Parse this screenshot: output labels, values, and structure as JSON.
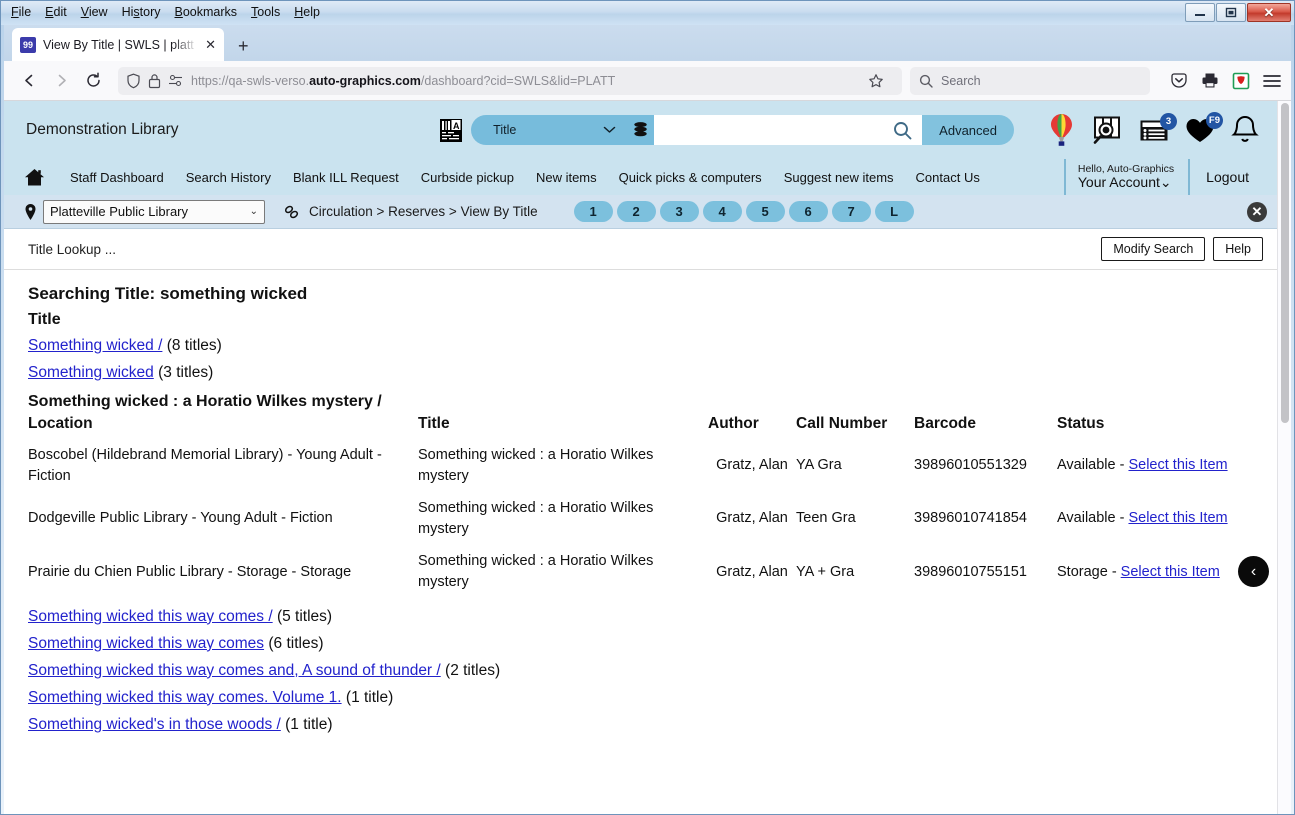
{
  "window": {
    "menus": [
      "File",
      "Edit",
      "View",
      "History",
      "Bookmarks",
      "Tools",
      "Help"
    ],
    "controls": {
      "minimize": "—",
      "maximize": "❐",
      "close": "✕"
    }
  },
  "browser": {
    "tab": {
      "title": "View By Title | SWLS | platt | Aut",
      "favicon_text": "99",
      "close": "✕"
    },
    "new_tab": "+",
    "url_prefix": "https://qa-swls-verso.",
    "url_bold": "auto-graphics.com",
    "url_suffix": "/dashboard?cid=SWLS&lid=PLATT",
    "search_placeholder": "Search",
    "icons": {
      "back": "back-arrow-icon",
      "forward": "forward-arrow-icon",
      "reload": "reload-icon",
      "shield": "shield-icon",
      "lock": "lock-icon",
      "permissions": "permissions-icon",
      "bookmark_star": "star-icon",
      "pocket": "pocket-icon",
      "print": "print-icon",
      "extension": "extension-icon",
      "menu": "hamburger-menu-icon"
    }
  },
  "app_header": {
    "library_name": "Demonstration Library",
    "scope_value": "Title",
    "search_value": "",
    "search_placeholder": "",
    "advanced_label": "Advanced",
    "icons": {
      "barcode": "barcode-scan-icon",
      "database": "database-icon",
      "search": "search-icon",
      "balloon": "hot-air-balloon-icon",
      "explore": "explore-search-icon",
      "list": "list-icon",
      "favorites": "heart-icon",
      "alerts": "bell-icon"
    },
    "list_badge": "3",
    "favorites_badge": "F9"
  },
  "app_nav": {
    "home_icon": "home-icon",
    "links": [
      "Staff Dashboard",
      "Search History",
      "Blank ILL Request",
      "Curbside pickup",
      "New items",
      "Quick picks & computers",
      "Suggest new items",
      "Contact Us"
    ],
    "account_hello": "Hello, Auto-Graphics",
    "account_name": "Your Account",
    "account_chevron": "⌄",
    "logout": "Logout"
  },
  "crumb_bar": {
    "pin_icon": "location-pin-icon",
    "library_select": "Platteville Public Library",
    "select_chevron": "⌄",
    "chain_icon": "link-chain-icon",
    "breadcrumb": "Circulation > Reserves > View By Title",
    "pages": [
      "1",
      "2",
      "3",
      "4",
      "5",
      "6",
      "7",
      "L"
    ],
    "close_icon": "✕"
  },
  "lookup_bar": {
    "label": "Title Lookup ...",
    "modify_search": "Modify Search",
    "help": "Help"
  },
  "results": {
    "searching_line": "Searching Title: something wicked",
    "column_label": "Title",
    "top_titles": [
      {
        "link": "Something wicked /",
        "count": "(8 titles)"
      },
      {
        "link": "Something wicked",
        "count": "(3 titles)"
      }
    ],
    "group_heading": "Something wicked : a Horatio Wilkes mystery /",
    "table": {
      "headers": [
        "Location",
        "Title",
        "Author",
        "Call Number",
        "Barcode",
        "Status"
      ],
      "rows": [
        {
          "location": "Boscobel (Hildebrand Memorial Library) - Young Adult - Fiction",
          "title": "Something wicked : a Horatio Wilkes mystery",
          "author": "Gratz, Alan",
          "call_number": "YA Gra",
          "barcode": "39896010551329",
          "status": "Available - ",
          "action": "Select this Item"
        },
        {
          "location": "Dodgeville Public Library - Young Adult - Fiction",
          "title": "Something wicked : a Horatio Wilkes mystery",
          "author": "Gratz, Alan",
          "call_number": "Teen Gra",
          "barcode": "39896010741854",
          "status": "Available - ",
          "action": "Select this Item"
        },
        {
          "location": "Prairie du Chien Public Library - Storage - Storage",
          "title": "Something wicked : a Horatio Wilkes mystery",
          "author": "Gratz, Alan",
          "call_number": "YA + Gra",
          "barcode": "39896010755151",
          "status": "Storage - ",
          "action": "Select this Item"
        }
      ]
    },
    "bottom_titles": [
      {
        "link": "Something wicked this way comes /",
        "count": "(5 titles)"
      },
      {
        "link": "Something wicked this way comes",
        "count": "(6 titles)"
      },
      {
        "link": "Something wicked this way comes and, A sound of thunder /",
        "count": "(2 titles)"
      },
      {
        "link": "Something wicked this way comes. Volume 1.",
        "count": "(1 title)"
      },
      {
        "link": "Something wicked's in those woods /",
        "count": "(1 title)"
      }
    ],
    "prev_arrow": "‹"
  }
}
